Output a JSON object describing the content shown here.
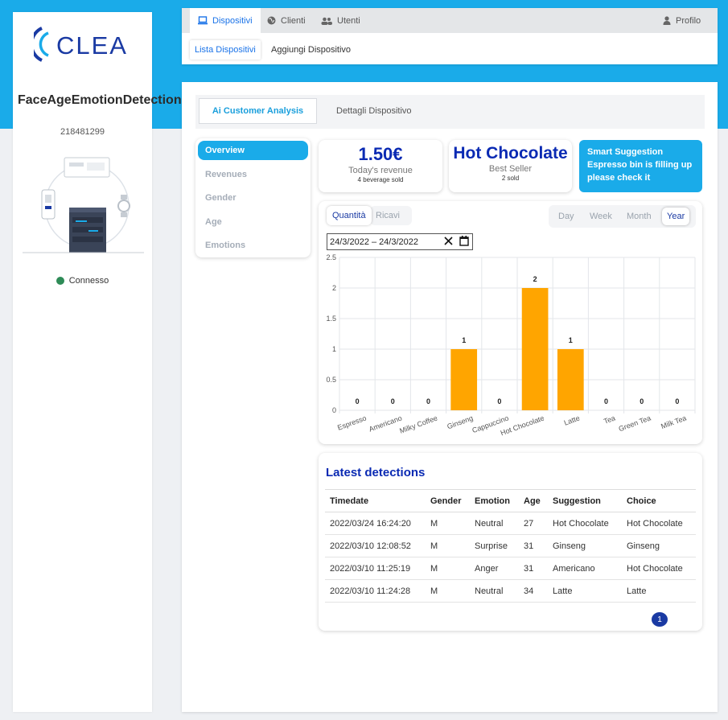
{
  "sidebar": {
    "logo_text": "CLEA",
    "device_name": "FaceAgeEmotionDetectionFinal",
    "device_id": "218481299",
    "status": "Connesso",
    "status_color": "#2e8b57"
  },
  "nav": {
    "tabs": [
      {
        "label": "Dispositivi",
        "icon": "laptop-icon",
        "active": true
      },
      {
        "label": "Clienti",
        "icon": "globe-icon",
        "active": false
      },
      {
        "label": "Utenti",
        "icon": "users-icon",
        "active": false
      }
    ],
    "profile": {
      "label": "Profilo",
      "icon": "user-icon"
    },
    "subtabs": [
      {
        "label": "Lista Dispositivi",
        "active": true
      },
      {
        "label": "Aggiungi Dispositivo",
        "active": false
      }
    ]
  },
  "main": {
    "tabs": [
      {
        "label": "Ai Customer Analysis",
        "active": true
      },
      {
        "label": "Dettagli Dispositivo",
        "active": false
      }
    ],
    "menu": [
      {
        "label": "Overview",
        "active": true
      },
      {
        "label": "Revenues",
        "active": false
      },
      {
        "label": "Gender",
        "active": false
      },
      {
        "label": "Age",
        "active": false
      },
      {
        "label": "Emotions",
        "active": false
      }
    ],
    "revenue": {
      "value": "1.50€",
      "label": "Today's revenue",
      "sub": "4 beverage sold"
    },
    "best_seller": {
      "value": "Hot Chocolate",
      "label": "Best Seller",
      "sub": "2 sold"
    },
    "suggestion": {
      "title": "Smart Suggestion",
      "text": "Espresso bin is filling up please check it"
    },
    "chart_controls": {
      "metric_toggle": [
        {
          "label": "Quantità",
          "active": true
        },
        {
          "label": "Ricavi",
          "active": false
        }
      ],
      "periods": [
        {
          "label": "Day",
          "active": false
        },
        {
          "label": "Week",
          "active": false
        },
        {
          "label": "Month",
          "active": false
        },
        {
          "label": "Year",
          "active": true
        }
      ],
      "date_from": "24/3/2022",
      "date_sep": "–",
      "date_to": "24/3/2022"
    },
    "detections": {
      "title": "Latest detections",
      "columns": [
        "Timedate",
        "Gender",
        "Emotion",
        "Age",
        "Suggestion",
        "Choice"
      ],
      "rows": [
        [
          "2022/03/24 16:24:20",
          "M",
          "Neutral",
          "27",
          "Hot Chocolate",
          "Hot Chocolate"
        ],
        [
          "2022/03/10 12:08:52",
          "M",
          "Surprise",
          "31",
          "Ginseng",
          "Ginseng"
        ],
        [
          "2022/03/10 11:25:19",
          "M",
          "Anger",
          "31",
          "Americano",
          "Hot Chocolate"
        ],
        [
          "2022/03/10 11:24:28",
          "M",
          "Neutral",
          "34",
          "Latte",
          "Latte"
        ]
      ],
      "page": "1"
    }
  },
  "colors": {
    "accent": "#1aabe9",
    "brand_dark": "#0a2ab3",
    "bar": "#ffa500"
  },
  "chart_data": {
    "type": "bar",
    "categories": [
      "Espresso",
      "Americano",
      "Milky Coffee",
      "Ginseng",
      "Cappuccino",
      "Hot Chocolate",
      "Latte",
      "Tea",
      "Green Tea",
      "Milk Tea"
    ],
    "values": [
      0,
      0,
      0,
      1,
      0,
      2,
      1,
      0,
      0,
      0
    ],
    "yticks": [
      "0",
      "0.5",
      "1",
      "1.5",
      "2",
      "2.5"
    ],
    "ylim": [
      0,
      2.5
    ],
    "grid": true,
    "data_labels": true,
    "title": "",
    "xlabel": "",
    "ylabel": ""
  }
}
